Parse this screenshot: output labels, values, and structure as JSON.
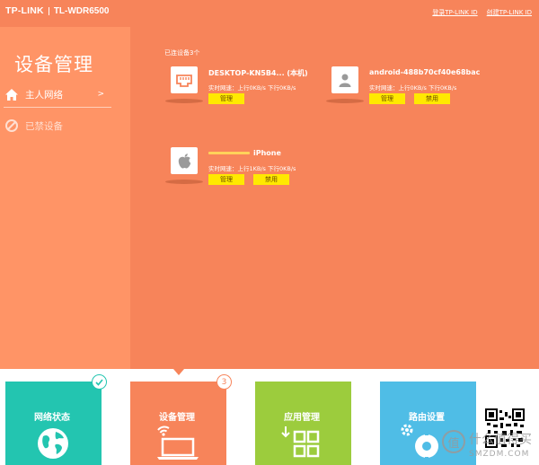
{
  "header": {
    "brand": "TP-LINK",
    "model": "TL-WDR6500",
    "login_link": "登录TP-LINK ID",
    "create_link": "创建TP-LINK ID"
  },
  "sidebar": {
    "title": "设备管理",
    "items": [
      {
        "label": "主人网络",
        "chevron": ">",
        "icon": "home-icon"
      },
      {
        "label": "已禁设备",
        "icon": "ban-icon"
      }
    ]
  },
  "main": {
    "connected_label": "已连设备3个",
    "devices": [
      {
        "name": "DESKTOP-KN5B4... (本机)",
        "speed": "实时网速：上行0KB/s  下行0KB/s",
        "manage": "管理",
        "icon": "ethernet-icon"
      },
      {
        "name": "android-488b70cf40e68bac",
        "speed": "实时网速：上行0KB/s  下行0KB/s",
        "manage": "管理",
        "block": "禁用",
        "icon": "person-icon"
      },
      {
        "name": "iPhone",
        "speed": "实时网速：上行1KB/s  下行0KB/s",
        "manage": "管理",
        "block": "禁用",
        "icon": "apple-icon"
      }
    ]
  },
  "footer": {
    "tiles": [
      {
        "label": "网络状态",
        "color": "#23c5b0",
        "icon": "globe-icon"
      },
      {
        "label": "设备管理",
        "color": "#f7845a",
        "badge": "3",
        "icon": "laptop-wifi-icon"
      },
      {
        "label": "应用管理",
        "color": "#9ccc3d",
        "icon": "apps-grid-icon"
      },
      {
        "label": "路由设置",
        "color": "#4fbde6",
        "icon": "router-settings-icon"
      }
    ],
    "watermark_main": "什么值得买",
    "watermark_sub": "SMZDM.COM"
  }
}
